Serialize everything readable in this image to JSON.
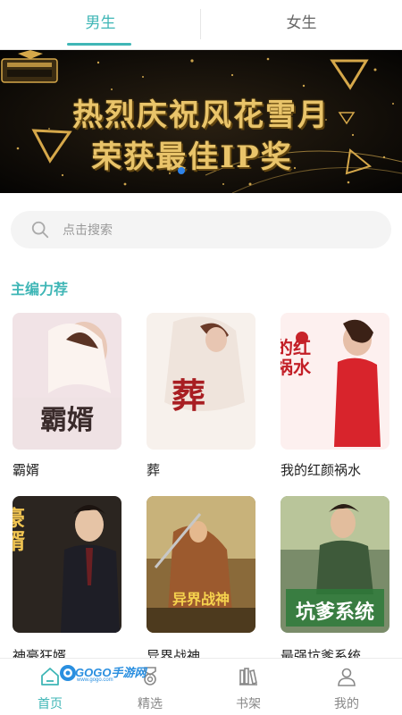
{
  "tabs": [
    {
      "label": "男生",
      "active": true
    },
    {
      "label": "女生",
      "active": false
    }
  ],
  "banner": {
    "line1": "热烈庆祝风花雪月",
    "line2": "荣获最佳IP奖",
    "logo_text": "最佳IP奖",
    "slide_count": 2,
    "active_slide": 1
  },
  "search": {
    "placeholder": "点击搜索"
  },
  "section": {
    "title": "主编力荐"
  },
  "books": [
    {
      "title": "霸婿",
      "cover_text": "霸婿",
      "cover_color": "#f2e4e6"
    },
    {
      "title": "葬",
      "cover_text": "葬",
      "cover_color": "#f6efe8"
    },
    {
      "title": "我的红颜祸水",
      "cover_text": "我的红颜祸水",
      "cover_color": "#fbe8e8"
    },
    {
      "title": "神豪狂婿",
      "cover_text": "神豪狂婿",
      "cover_color": "#2b2520"
    },
    {
      "title": "异界战神",
      "cover_text": "异界战神",
      "cover_color": "#7a5a2c"
    },
    {
      "title": "最强坑爹系统",
      "cover_text": "坑爹系统",
      "cover_color": "#5d7a5a"
    }
  ],
  "bottom_nav": [
    {
      "label": "首页",
      "icon": "home-icon",
      "active": true
    },
    {
      "label": "精选",
      "icon": "medal-icon",
      "active": false
    },
    {
      "label": "书架",
      "icon": "bookshelf-icon",
      "active": false
    },
    {
      "label": "我的",
      "icon": "user-icon",
      "active": false
    }
  ],
  "watermark": {
    "text": "GOGO手游网",
    "subtext": "www.gogo.com"
  },
  "colors": {
    "accent": "#3fb6b6",
    "banner_gold": "#e9c46a",
    "dot_active": "#2f83e9"
  }
}
